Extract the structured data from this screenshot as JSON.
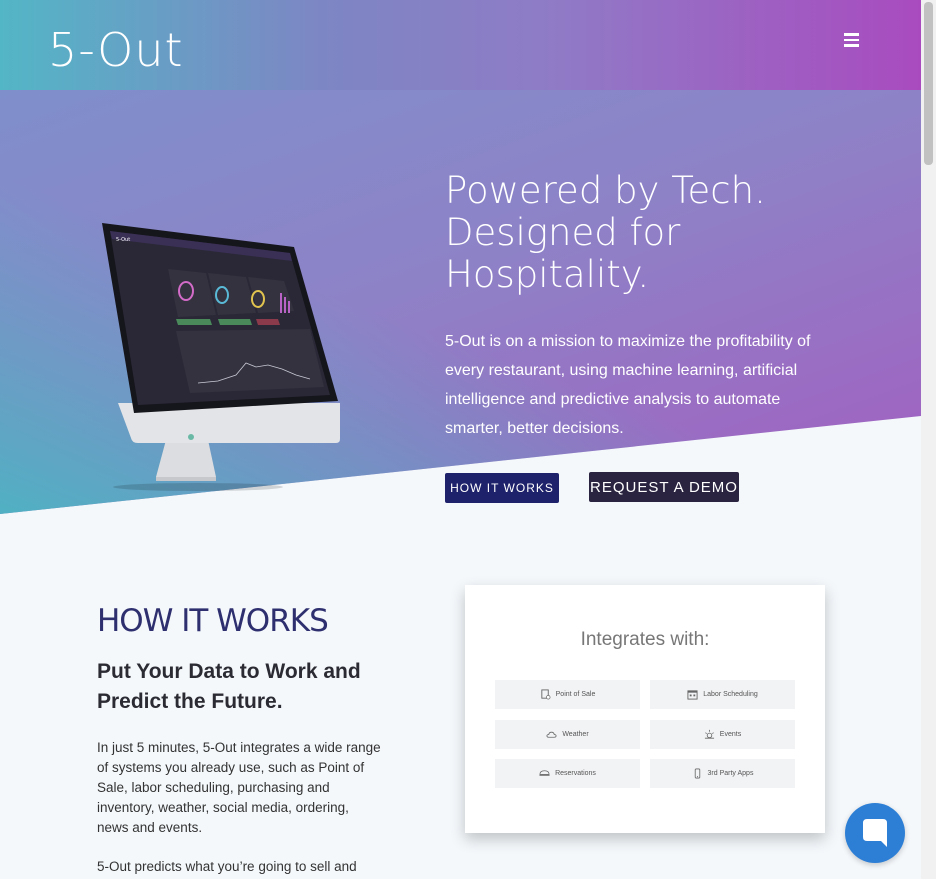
{
  "header": {
    "logo": "5-Out",
    "menu_icon": "hamburger-menu-icon"
  },
  "hero": {
    "title": "Powered by Tech.\nDesigned for\nHospitality.",
    "description": "5-Out is on a mission to maximize the profitability of every restaurant, using machine learning, artificial intelligence and predictive analysis to automate smarter, better decisions.",
    "btn_how": "HOW IT WORKS",
    "btn_demo": "REQUEST A DEMO"
  },
  "how": {
    "title": "HOW IT WORKS",
    "subtitle": "Put Your Data to Work and Predict the Future.",
    "p1": "In just 5 minutes, 5-Out integrates a wide range of systems you already use, such as Point of Sale, labor scheduling, purchasing and inventory, weather, social media, ordering, news and events.",
    "p2": "5-Out predicts what you’re going to sell and"
  },
  "card": {
    "title": "Integrates with:",
    "chips": [
      {
        "label": "Point of Sale",
        "icon": "pos-icon"
      },
      {
        "label": "Labor Scheduling",
        "icon": "calendar-icon"
      },
      {
        "label": "Weather",
        "icon": "cloud-icon"
      },
      {
        "label": "Events",
        "icon": "event-icon"
      },
      {
        "label": "Reservations",
        "icon": "reservation-icon"
      },
      {
        "label": "3rd Party Apps",
        "icon": "phone-icon"
      }
    ]
  },
  "chat": {
    "icon": "chat-bubble-icon"
  },
  "colors": {
    "header_start": "#53b6c6",
    "header_end": "#a94bbf",
    "btn_how": "#1e226b",
    "btn_demo": "#2b2440",
    "chat": "#2d7fd6"
  }
}
